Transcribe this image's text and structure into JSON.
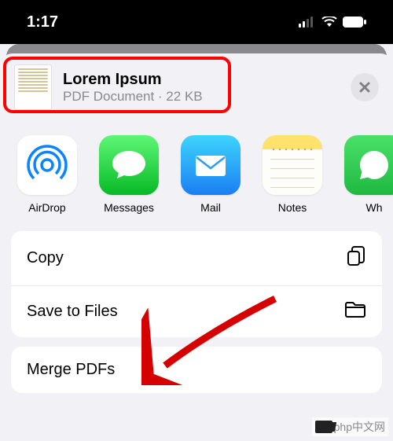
{
  "status": {
    "time": "1:17"
  },
  "document": {
    "title": "Lorem Ipsum",
    "subtitle": "PDF Document · 22 KB"
  },
  "apps": {
    "airdrop": "AirDrop",
    "messages": "Messages",
    "mail": "Mail",
    "notes": "Notes",
    "whatsapp": "Wh"
  },
  "actions": {
    "copy": "Copy",
    "save": "Save to Files",
    "merge": "Merge PDFs"
  },
  "watermark": "php中文网"
}
